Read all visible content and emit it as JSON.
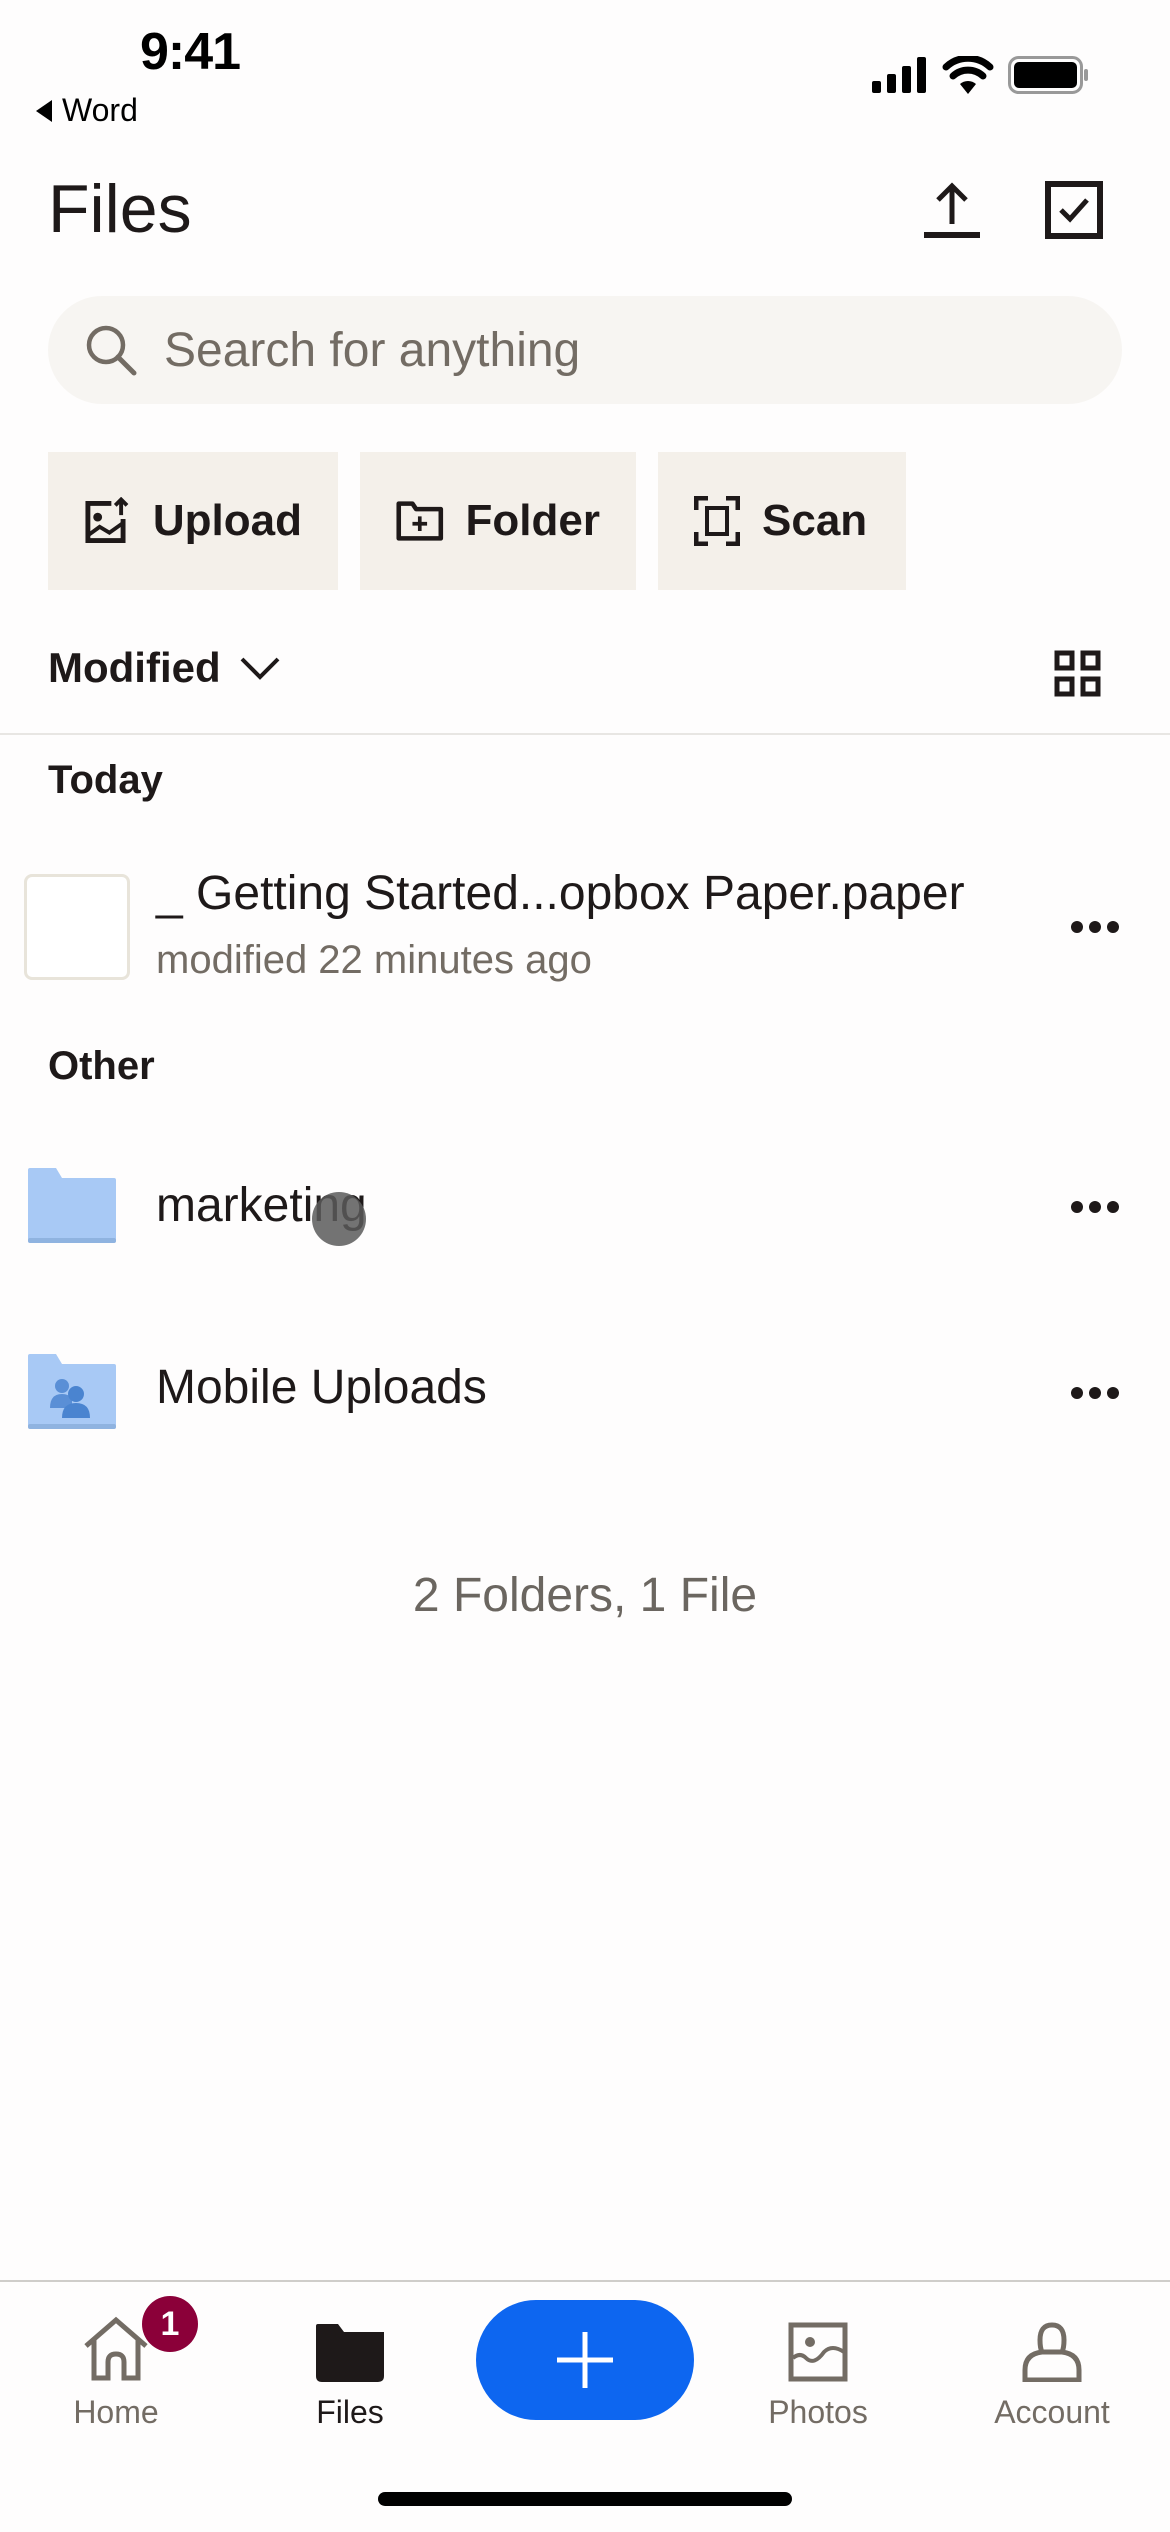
{
  "status_bar": {
    "time": "9:41",
    "back_app": "Word",
    "icons": [
      "signal-icon",
      "wifi-icon",
      "battery-icon"
    ]
  },
  "header": {
    "title": "Files",
    "upload_icon": "upload-arrow-icon",
    "select_icon": "checkbox-select-icon"
  },
  "search": {
    "placeholder": "Search for anything",
    "value": ""
  },
  "actions": [
    {
      "label": "Upload",
      "icon": "upload-photo-icon"
    },
    {
      "label": "Folder",
      "icon": "new-folder-icon"
    },
    {
      "label": "Scan",
      "icon": "scan-icon"
    }
  ],
  "sort": {
    "label": "Modified",
    "icon": "chevron-down-icon",
    "view_toggle_icon": "grid-view-icon"
  },
  "sections": [
    {
      "label": "Today",
      "items": [
        {
          "name": "_ Getting Started...opbox Paper.paper",
          "meta": "modified 22 minutes ago",
          "type": "paper-file"
        }
      ]
    },
    {
      "label": "Other",
      "items": [
        {
          "name": "marketing",
          "meta": "",
          "type": "folder"
        },
        {
          "name": "Mobile Uploads",
          "meta": "",
          "type": "shared-folder"
        }
      ]
    }
  ],
  "summary": "2 Folders, 1 File",
  "tabbar": {
    "tabs": [
      {
        "label": "Home",
        "icon": "home-icon",
        "badge": "1",
        "active": false
      },
      {
        "label": "Files",
        "icon": "folder-icon",
        "active": true
      },
      {
        "label": "Photos",
        "icon": "photo-icon",
        "active": false
      },
      {
        "label": "Account",
        "icon": "account-icon",
        "active": false
      }
    ],
    "create_icon": "plus-icon"
  },
  "colors": {
    "accent": "#0d66f0",
    "badge": "#8b0039",
    "action_bg": "#f4f0ea",
    "search_bg": "#f7f5f2",
    "folder": "#a8c9f5"
  }
}
